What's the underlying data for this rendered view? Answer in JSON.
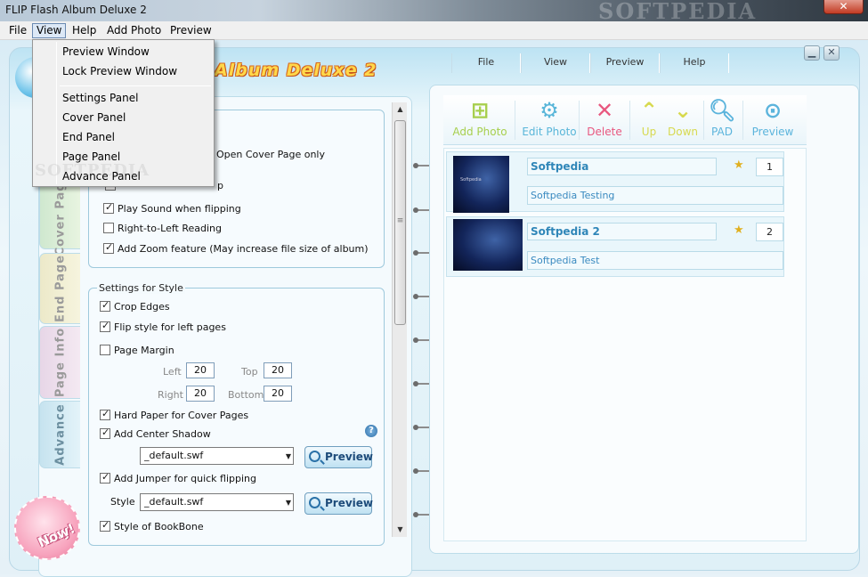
{
  "window": {
    "title": "FLIP Flash Album Deluxe 2",
    "watermark": "SOFTPEDIA",
    "close_glyph": "✕"
  },
  "menubar": {
    "items": [
      "File",
      "View",
      "Help",
      "Add Photo",
      "Preview"
    ],
    "active": "View"
  },
  "view_menu": {
    "items": [
      "Preview Window",
      "Lock Preview Window",
      "Settings Panel",
      "Cover Panel",
      "End Panel",
      "Page Panel",
      "Advance Panel"
    ],
    "watermark": "SOFTPEDIA"
  },
  "app": {
    "logo_text": "Album Deluxe 2",
    "top_nav": [
      "File",
      "View",
      "Preview",
      "Help"
    ],
    "min_glyph": "▁",
    "close_glyph": "✕"
  },
  "side_tabs": [
    "Cover Page",
    "End Page",
    "Page Info",
    "Advance"
  ],
  "settings": {
    "open_cover_only": "Open Cover Page only",
    "hidden_row": "p",
    "play_sound": "Play Sound when flipping",
    "rtl": "Right-to-Left Reading",
    "zoom": "Add Zoom feature (May increase file size of album)",
    "style_group": "Settings for Style",
    "crop_edges": "Crop Edges",
    "flip_left": "Flip style for left pages",
    "page_margin": "Page Margin",
    "margins": {
      "left_label": "Left",
      "left": "20",
      "top_label": "Top",
      "top": "20",
      "right_label": "Right",
      "right": "20",
      "bottom_label": "Bottom",
      "bottom": "20"
    },
    "hard_paper": "Hard Paper for Cover Pages",
    "center_shadow": "Add Center Shadow",
    "shadow_swf": "_default.swf",
    "jumper": "Add Jumper for quick flipping",
    "style_label": "Style",
    "jumper_swf": "_default.swf",
    "bookbone": "Style of BookBone",
    "preview_btn": "Preview",
    "help_glyph": "?"
  },
  "checks": {
    "play_sound": true,
    "rtl": false,
    "zoom": true,
    "crop_edges": true,
    "flip_left": true,
    "page_margin": false,
    "hard_paper": true,
    "center_shadow": true,
    "jumper": true,
    "bookbone": true
  },
  "buy": {
    "line1": "Buy",
    "line2": "Now!"
  },
  "toolbar": {
    "add_photo": "Add Photo",
    "edit_photo": "Edit Photo",
    "delete": "Delete",
    "up": "Up",
    "down": "Down",
    "pad": "PAD",
    "preview": "Preview"
  },
  "colors": {
    "add": "#a7cf4d",
    "edit": "#59b6d9",
    "delete": "#e8577f",
    "updown": "#d7d94e",
    "pad": "#5bb4dc"
  },
  "albums": [
    {
      "title": "Softpedia",
      "desc": "Softpedia Testing",
      "page": "1",
      "thumb_text": "Softpedia"
    },
    {
      "title": "Softpedia 2",
      "desc": "Softpedia Test",
      "page": "2",
      "thumb_text": ""
    }
  ]
}
